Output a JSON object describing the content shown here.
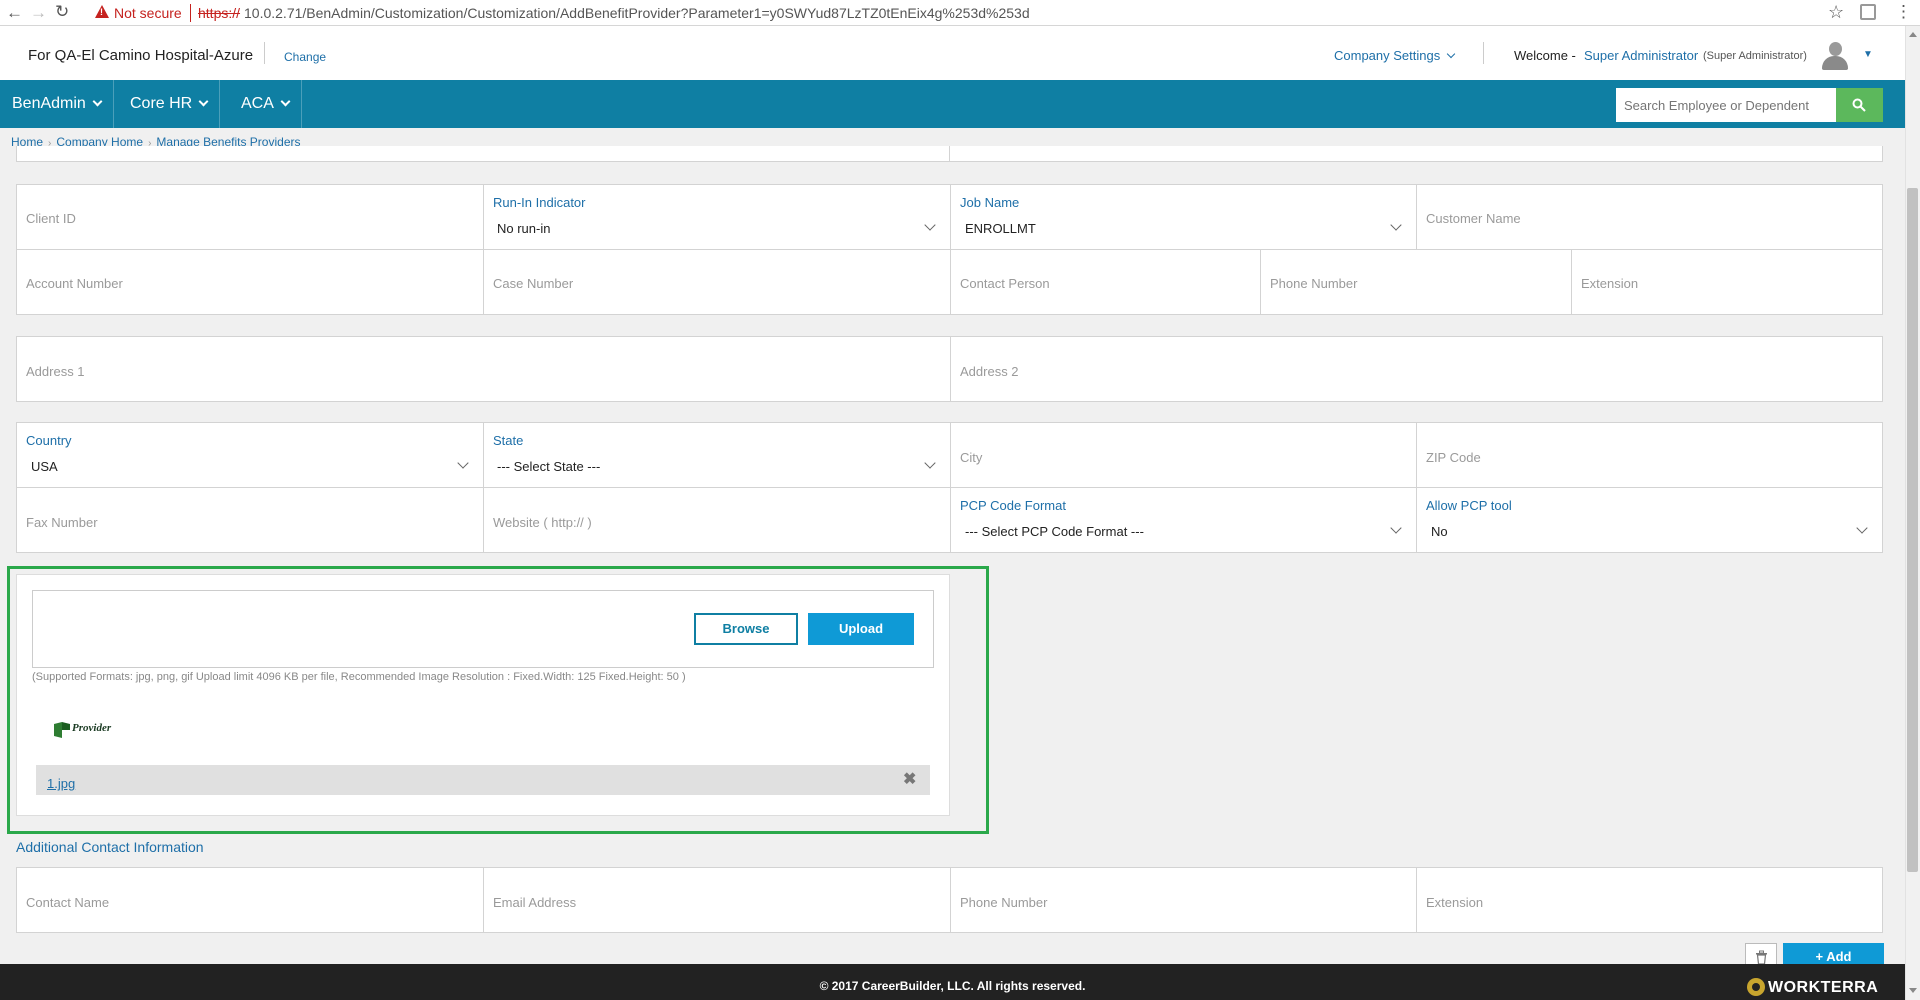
{
  "browser": {
    "not_secure": "Not secure",
    "url_scheme": "https://",
    "url_rest": "10.0.2.71/BenAdmin/Customization/Customization/AddBenefitProvider?Parameter1=y0SWYud87LzTZ0tEnEix4g%253d%253d"
  },
  "header": {
    "company": "For QA-El Camino Hospital-Azure",
    "change": "Change",
    "company_settings": "Company Settings",
    "welcome": "Welcome -",
    "user_name": "Super Administrator",
    "user_role": "(Super Administrator)"
  },
  "nav": {
    "items": [
      {
        "label": "BenAdmin"
      },
      {
        "label": "Core HR"
      },
      {
        "label": "ACA"
      }
    ],
    "search_placeholder": "Search Employee or Dependent"
  },
  "breadcrumb": [
    "Home",
    "Company Home",
    "Manage Benefits Providers"
  ],
  "form": {
    "client_id": "Client ID",
    "run_in_label": "Run-In Indicator",
    "run_in_value": "No run-in",
    "job_name_label": "Job Name",
    "job_name_value": "ENROLLMT",
    "customer_name": "Customer Name",
    "account_number": "Account Number",
    "case_number": "Case Number",
    "contact_person": "Contact Person",
    "phone_number": "Phone Number",
    "extension": "Extension",
    "address1": "Address 1",
    "address2": "Address 2",
    "country_label": "Country",
    "country_value": "USA",
    "state_label": "State",
    "state_value": "--- Select State ---",
    "city": "City",
    "zip": "ZIP Code",
    "fax": "Fax Number",
    "website": "Website ( http:// )",
    "pcp_label": "PCP Code Format",
    "pcp_value": "--- Select PCP Code Format ---",
    "allow_pcp_label": "Allow PCP tool",
    "allow_pcp_value": "No"
  },
  "upload": {
    "browse": "Browse",
    "upload": "Upload",
    "note": "(Supported Formats: jpg, png, gif Upload limit 4096 KB per file, Recommended Image Resolution : Fixed.Width: 125 Fixed.Height: 50 )",
    "logo_text": "Provider",
    "file_name": "1.jpg"
  },
  "additional_contact": {
    "title": "Additional Contact Information",
    "contact_name": "Contact Name",
    "email": "Email Address",
    "phone": "Phone Number",
    "extension": "Extension",
    "add": "+ Add"
  },
  "footer": {
    "copyright": "© 2017 CareerBuilder, LLC. All rights reserved.",
    "brand": "WORKTERRA"
  },
  "colors": {
    "accent": "#0f7fa3",
    "link": "#1e6fa8",
    "highlight": "#2aa84a",
    "search_button": "#5cb85c"
  },
  "icons": [
    "back-icon",
    "forward-icon",
    "reload-icon",
    "warning-icon",
    "star-icon",
    "extension-icon",
    "menu-icon",
    "chevron-down-icon",
    "search-icon",
    "avatar-icon",
    "close-icon",
    "trash-icon",
    "scroll-up-icon",
    "scroll-down-icon"
  ]
}
